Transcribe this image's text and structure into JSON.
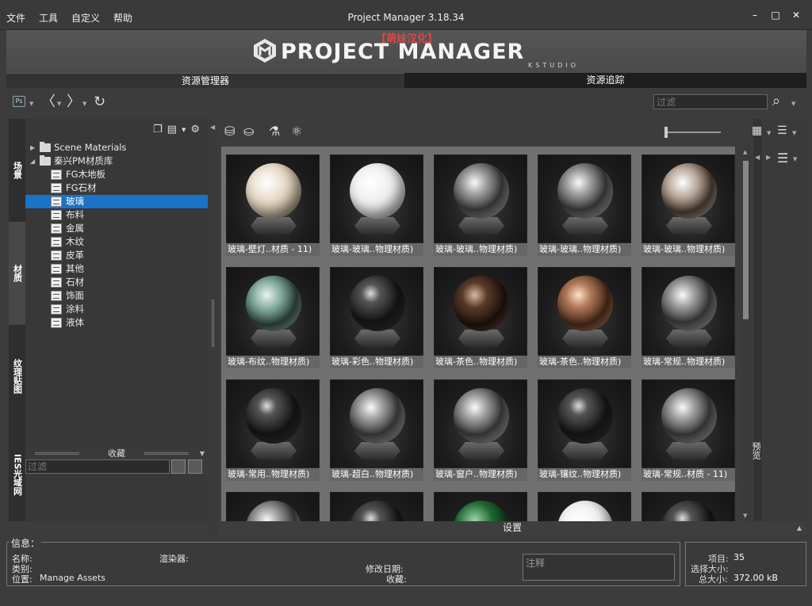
{
  "menu": [
    "文件",
    "工具",
    "自定义",
    "帮助"
  ],
  "app_title": "Project Manager 3.18.34",
  "window_controls": {
    "minimize": "–",
    "maximize": "□",
    "close": "✕"
  },
  "banner": {
    "badge": "【萌妹汉化】",
    "name": "PROJECT MANAGER",
    "sub": "KSTUDIO"
  },
  "tabs": [
    {
      "label": "资源管理器",
      "active": true
    },
    {
      "label": "资源追踪",
      "active": false
    }
  ],
  "toolbar": {
    "ps_label": "Ps",
    "back": "〈",
    "forward": "〉",
    "refresh": "↻",
    "filter_placeholder": "过滤",
    "search_icon": "⌕"
  },
  "left_tabs": [
    "场景",
    "材质",
    "纹理贴图",
    "IES光域网"
  ],
  "tree": {
    "roots": [
      {
        "label": "Scene Materials",
        "expanded": false
      },
      {
        "label": "秦兴PM材质库",
        "expanded": true
      }
    ],
    "children": [
      "FG木地板",
      "FG石材",
      "玻璃",
      "布料",
      "金属",
      "木纹",
      "皮革",
      "其他",
      "石材",
      "饰面",
      "涂料",
      "液体"
    ],
    "selected": "玻璃"
  },
  "favorites": {
    "label": "收藏",
    "filter_placeholder": "过滤"
  },
  "content": {
    "items": [
      {
        "caption": "玻璃-壁灯..材质 - 11)",
        "tone": "warm-white"
      },
      {
        "caption": "玻璃-玻璃..物理材质)",
        "tone": "white"
      },
      {
        "caption": "玻璃-玻璃..物理材质)",
        "tone": "clear"
      },
      {
        "caption": "玻璃-玻璃..物理材质)",
        "tone": "clear"
      },
      {
        "caption": "玻璃-玻璃..物理材质)",
        "tone": "clear-warm"
      },
      {
        "caption": "玻璃-布纹..物理材质)",
        "tone": "green-tint"
      },
      {
        "caption": "玻璃-彩色..物理材质)",
        "tone": "dark"
      },
      {
        "caption": "玻璃-茶色..物理材质)",
        "tone": "bronze-dark"
      },
      {
        "caption": "玻璃-茶色..物理材质)",
        "tone": "bronze"
      },
      {
        "caption": "玻璃-常规..物理材质)",
        "tone": "clear"
      },
      {
        "caption": "玻璃-常用..物理材质)",
        "tone": "dark"
      },
      {
        "caption": "玻璃-超白..物理材质)",
        "tone": "clear"
      },
      {
        "caption": "玻璃-窗户..物理材质)",
        "tone": "clear"
      },
      {
        "caption": "玻璃-镶纹..物理材质)",
        "tone": "dark"
      },
      {
        "caption": "玻璃-常规..材质 - 11)",
        "tone": "clear"
      },
      {
        "caption": "",
        "tone": "clear"
      },
      {
        "caption": "",
        "tone": "dark"
      },
      {
        "caption": "",
        "tone": "green"
      },
      {
        "caption": "",
        "tone": "white"
      },
      {
        "caption": "",
        "tone": "dark"
      }
    ]
  },
  "settings_label": "设置",
  "right_label": "预览",
  "info": {
    "title": "信息：",
    "name_label": "名称:",
    "category_label": "类别:",
    "location_label": "位置:",
    "location_value": "Manage Assets",
    "renderer_label": "渲染器:",
    "modified_label": "修改日期:",
    "favorite_label": "收藏:",
    "notes_placeholder": "注释"
  },
  "stats": {
    "items_label": "项目:",
    "items_value": "35",
    "selected_size_label": "选择大小:",
    "total_size_label": "总大小:",
    "total_size_value": "372.00 kB"
  }
}
